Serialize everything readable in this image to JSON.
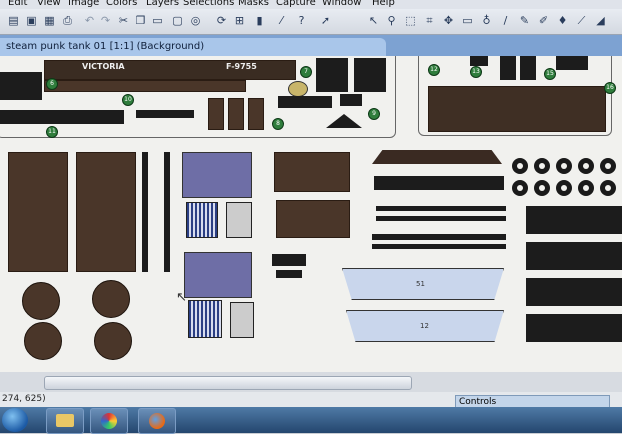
{
  "menu": [
    "Edit",
    "View",
    "Image",
    "Colors",
    "Layers",
    "Selections",
    "Masks",
    "Capture",
    "Window",
    "Help"
  ],
  "toolbar": {
    "icons": [
      "open-icon",
      "save-icon",
      "save-as-icon",
      "print-icon",
      "undo-icon",
      "redo-icon",
      "cut-icon",
      "copy-icon",
      "paste-icon",
      "screen-icon",
      "browse-icon",
      "rotate-icon",
      "resize-icon",
      "histogram-icon",
      "eyedropper-icon",
      "help-pointer-icon",
      "arrow-select-icon",
      "zoom-icon",
      "deform-icon",
      "crop-icon",
      "move-icon",
      "selection-icon",
      "lasso-icon",
      "brush-icon",
      "pen-icon",
      "clone-icon",
      "fill-icon",
      "eraser-icon"
    ]
  },
  "document_tab": {
    "label": "steam punk tank 01 [1:1] (Background)"
  },
  "canvas": {
    "texts": {
      "victoria": "VICTORIA",
      "plate": "F-9755",
      "label_51": "51",
      "label_12": "12"
    },
    "badges": [
      "6",
      "7",
      "8",
      "9",
      "10",
      "11",
      "12",
      "13",
      "15",
      "16"
    ]
  },
  "status": {
    "coordinates": "274, 625)"
  },
  "controls_panel": {
    "title": "Controls"
  },
  "taskbar": {
    "items": [
      "start-button",
      "explorer-button",
      "paint-shop-button",
      "firefox-button"
    ]
  }
}
